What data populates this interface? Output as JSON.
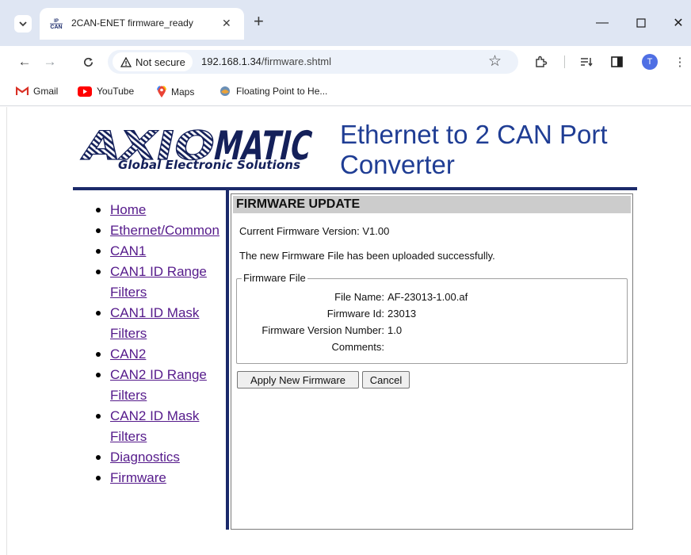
{
  "browser": {
    "tab": {
      "favicon_text": "IP CAN",
      "title": "2CAN-ENET firmware_ready"
    },
    "address": {
      "security_label": "Not secure",
      "url_host": "192.168.1.34",
      "url_path": "/firmware.shtml"
    },
    "profile_initial": "T",
    "bookmarks": [
      {
        "label": "Gmail",
        "icon": "gmail-icon"
      },
      {
        "label": "YouTube",
        "icon": "youtube-icon"
      },
      {
        "label": "Maps",
        "icon": "maps-icon"
      },
      {
        "label": "Floating Point to He...",
        "icon": "site-icon"
      }
    ]
  },
  "page": {
    "logo_text": "AXIOMATIC",
    "logo_subtitle": "Global Electronic Solutions",
    "title": "Ethernet to 2 CAN Port Converter",
    "menu": [
      "Home",
      "Ethernet/Common",
      "CAN1",
      "CAN1 ID Range Filters",
      "CAN1 ID Mask Filters",
      "CAN2",
      "CAN2 ID Range Filters",
      "CAN2 ID Mask Filters",
      "Diagnostics",
      "Firmware"
    ],
    "section_heading": "FIRMWARE UPDATE",
    "current_version": "Current Firmware Version: V1.00",
    "status_message": "The new Firmware File has been uploaded successfully.",
    "firmware_file": {
      "legend": "Firmware File",
      "file_name_label": "File Name:",
      "file_name": "AF-23013-1.00.af",
      "firmware_id_label": "Firmware Id:",
      "firmware_id": "23013",
      "version_number_label": "Firmware Version Number:",
      "version_number": "1.0",
      "comments_label": "Comments:",
      "comments": ""
    },
    "buttons": {
      "apply": "Apply New Firmware",
      "cancel": "Cancel"
    }
  },
  "colors": {
    "title_blue": "#1f3d94",
    "rule_navy": "#1b2a6a",
    "link_visited": "#551a8b",
    "heading_bar": "#cccccc"
  }
}
